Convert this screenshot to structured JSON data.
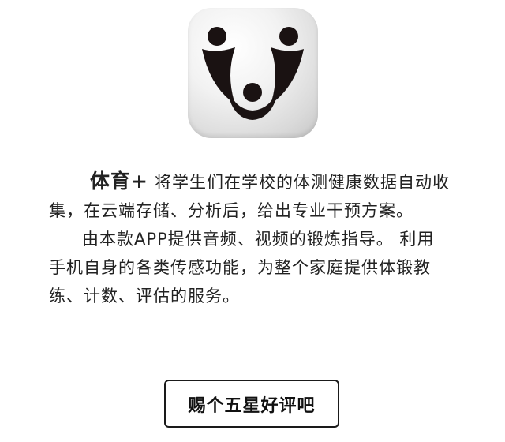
{
  "app": {
    "brand": "体育+",
    "icon": "sport-plus-logo-icon"
  },
  "description": {
    "paragraph1_rest": "将学生们在学校的体测健康数据自动收集，在云端存储、分析后，给出专业干预方案。",
    "paragraph2": "由本款APP提供音频、视频的锻炼指导。 利用手机自身的各类传感功能，为整个家庭提供体锻教练、计数、评估的服务。"
  },
  "actions": {
    "rate_label": "赐个五星好评吧"
  },
  "colors": {
    "logo": "#1a1212",
    "text": "#222222",
    "button_border": "#1a1a1a"
  }
}
